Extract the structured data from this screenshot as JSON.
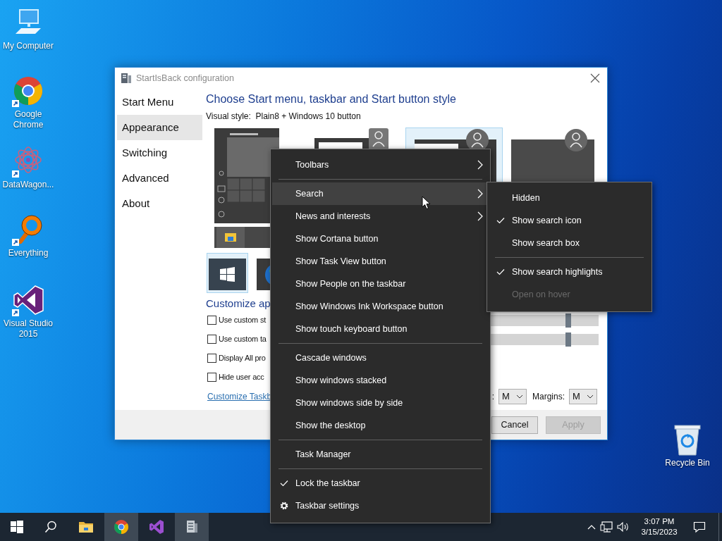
{
  "desktop_icons": [
    {
      "label": "My Computer"
    },
    {
      "label": "Google Chrome"
    },
    {
      "label": "DataWagon..."
    },
    {
      "label": "Everything"
    },
    {
      "label": "Visual Studio 2015"
    }
  ],
  "recycle_bin": {
    "label": "Recycle Bin"
  },
  "window": {
    "title": "StartIsBack configuration",
    "sidebar": [
      {
        "label": "Start Menu",
        "selected": false
      },
      {
        "label": "Appearance",
        "selected": true
      },
      {
        "label": "Switching",
        "selected": false
      },
      {
        "label": "Advanced",
        "selected": false
      },
      {
        "label": "About",
        "selected": false
      }
    ],
    "heading": "Choose Start menu, taskbar and Start button style",
    "visual_style": "Visual style:  Plain8 + Windows 10 button",
    "styles": [
      {
        "selected": false
      },
      {
        "selected": false
      },
      {
        "selected": true
      },
      {
        "selected": false
      }
    ],
    "start_buttons": [
      {
        "selected": true
      },
      {
        "selected": false
      }
    ],
    "customize_heading": "Customize ap",
    "options": [
      {
        "label": "Use custom st",
        "checked": false
      },
      {
        "label": "Use custom ta",
        "checked": false
      },
      {
        "label": "Display All pro",
        "checked": false
      },
      {
        "label": "Hide user acc",
        "checked": false
      }
    ],
    "sliders": [
      {
        "level": 0.85
      },
      {
        "level": 0.85
      }
    ],
    "link": "Customize Taskb",
    "dropdowns": [
      {
        "label": ":",
        "value": "M"
      },
      {
        "label": "Margins:",
        "value": "M"
      }
    ],
    "buttons": [
      {
        "label": "Cancel",
        "disabled": false
      },
      {
        "label": "Apply",
        "disabled": true
      }
    ]
  },
  "context_menu": [
    {
      "kind": "submenu",
      "label": "Toolbars",
      "selected": false
    },
    {
      "kind": "separator"
    },
    {
      "kind": "submenu",
      "label": "Search",
      "selected": true
    },
    {
      "kind": "submenu",
      "label": "News and interests",
      "selected": false
    },
    {
      "kind": "toggle",
      "label": "Show Cortana button",
      "checked": false,
      "selected": false
    },
    {
      "kind": "toggle",
      "label": "Show Task View button",
      "checked": false,
      "selected": false
    },
    {
      "kind": "toggle",
      "label": "Show People on the taskbar",
      "checked": false,
      "selected": false
    },
    {
      "kind": "toggle",
      "label": "Show Windows Ink Workspace button",
      "checked": false,
      "selected": false
    },
    {
      "kind": "toggle",
      "label": "Show touch keyboard button",
      "checked": false,
      "selected": false
    },
    {
      "kind": "separator"
    },
    {
      "kind": "command",
      "label": "Cascade windows",
      "selected": false
    },
    {
      "kind": "command",
      "label": "Show windows stacked",
      "selected": false
    },
    {
      "kind": "command",
      "label": "Show windows side by side",
      "selected": false
    },
    {
      "kind": "command",
      "label": "Show the desktop",
      "selected": false
    },
    {
      "kind": "separator"
    },
    {
      "kind": "command",
      "label": "Task Manager",
      "selected": false
    },
    {
      "kind": "separator"
    },
    {
      "kind": "toggle",
      "label": "Lock the taskbar",
      "checked": true,
      "selected": false
    },
    {
      "kind": "settings",
      "label": "Taskbar settings",
      "selected": false
    }
  ],
  "submenu": [
    {
      "kind": "radio",
      "label": "Hidden",
      "checked": false,
      "disabled": false
    },
    {
      "kind": "radio",
      "label": "Show search icon",
      "checked": true,
      "disabled": false
    },
    {
      "kind": "radio",
      "label": "Show search box",
      "checked": false,
      "disabled": false
    },
    {
      "kind": "separator"
    },
    {
      "kind": "toggle",
      "label": "Show search highlights",
      "checked": true,
      "disabled": false
    },
    {
      "kind": "toggle",
      "label": "Open on hover",
      "checked": false,
      "disabled": true
    }
  ],
  "taskbar": {
    "apps": [
      {
        "selected": false
      },
      {
        "selected": true
      },
      {
        "selected": false
      },
      {
        "selected": true
      }
    ],
    "time": "3:07 PM",
    "date": "3/15/2023"
  }
}
